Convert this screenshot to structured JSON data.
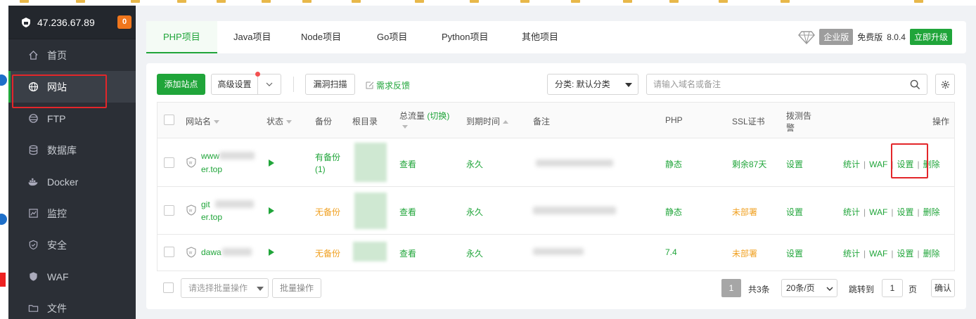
{
  "sidebar": {
    "server_ip": "47.236.67.89",
    "badge": "0",
    "items": [
      {
        "label": "首页",
        "icon": "home-icon"
      },
      {
        "label": "网站",
        "icon": "globe-icon",
        "active": true
      },
      {
        "label": "FTP",
        "icon": "ftp-icon"
      },
      {
        "label": "数据库",
        "icon": "database-icon"
      },
      {
        "label": "Docker",
        "icon": "docker-icon"
      },
      {
        "label": "监控",
        "icon": "monitor-icon"
      },
      {
        "label": "安全",
        "icon": "shield-icon"
      },
      {
        "label": "WAF",
        "icon": "waf-shield-icon"
      },
      {
        "label": "文件",
        "icon": "folder-icon"
      }
    ]
  },
  "tabs": [
    "PHP项目",
    "Java项目",
    "Node项目",
    "Go项目",
    "Python项目",
    "其他项目"
  ],
  "edition": {
    "chip": "企业版",
    "free": "免费版",
    "version": "8.0.4",
    "upgrade": "立即升级"
  },
  "toolbar": {
    "add_site": "添加站点",
    "advanced": "高级设置",
    "scan": "漏洞扫描",
    "feedback": "需求反馈",
    "category": "分类: 默认分类",
    "search_placeholder": "请输入域名或备注"
  },
  "table": {
    "headers": {
      "name": "网站名",
      "status": "状态",
      "backup": "备份",
      "root": "根目录",
      "traffic": "总流量",
      "traffic_switch": "(切换)",
      "expire": "到期时间",
      "note": "备注",
      "php": "PHP",
      "ssl": "SSL证书",
      "alert_1": "拨测告",
      "alert_2": "警",
      "ops": "操作"
    },
    "rows": [
      {
        "name_1": "www",
        "name_2": "er.top",
        "backup_1": "有备份",
        "backup_2": "(1)",
        "traffic": "查看",
        "expire": "永久",
        "php": "静态",
        "ssl": "剩余87天",
        "alert": "设置"
      },
      {
        "name_1": "git",
        "name_2": "er.top",
        "backup_1": "无备份",
        "backup_2": "",
        "traffic": "查看",
        "expire": "永久",
        "php": "静态",
        "ssl": "未部署",
        "alert": "设置"
      },
      {
        "name_1": "dawa",
        "name_2": "",
        "backup_1": "无备份",
        "backup_2": "",
        "traffic": "查看",
        "expire": "永久",
        "php": "7.4",
        "ssl": "未部署",
        "alert": "设置"
      }
    ],
    "ops": {
      "stats": "统计",
      "waf": "WAF",
      "settings": "设置",
      "delete": "删除",
      "sep": "|"
    }
  },
  "footer": {
    "batch_placeholder": "请选择批量操作",
    "batch_btn": "批量操作",
    "page": "1",
    "total": "共3条",
    "per_page": "20条/页",
    "goto": "跳转到",
    "goto_value": "1",
    "page_unit": "页",
    "confirm": "确认"
  },
  "colors": {
    "accent": "#20a53a",
    "warning": "#f0a020",
    "highlight": "#e3262a",
    "sidebar": "#2b2f36"
  }
}
